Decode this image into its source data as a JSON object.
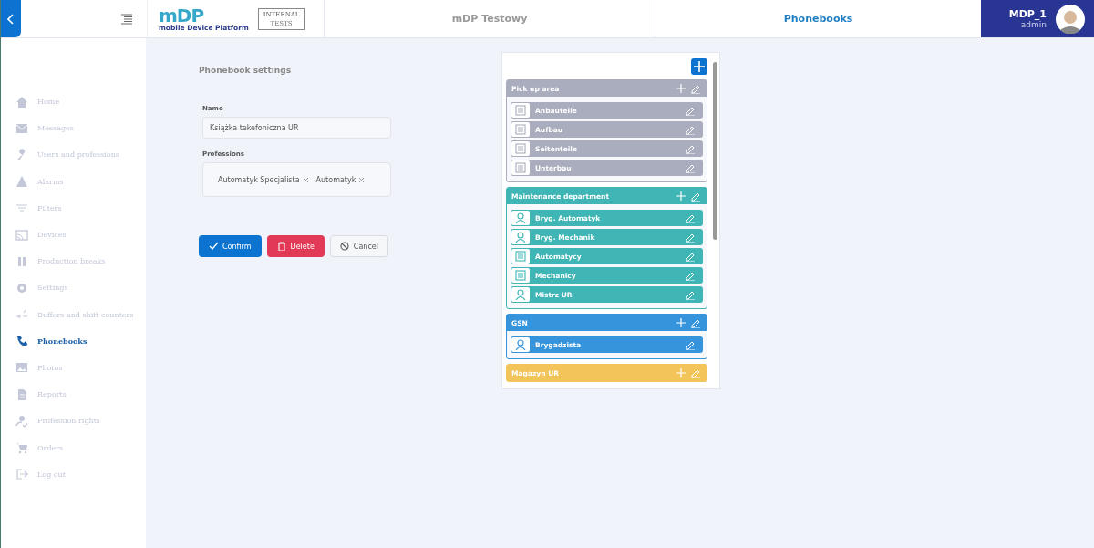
{
  "header": {
    "logo": {
      "mark": "mDP",
      "tagline": "mobile Device Platform"
    },
    "stamp": {
      "lines": [
        "INTERNAL",
        "TESTS"
      ]
    },
    "environment": "mDP Testowy",
    "page_title": "Phonebooks",
    "user": {
      "name": "MDP_1",
      "role": "admin"
    }
  },
  "sidebar": {
    "items": [
      {
        "label": "Home",
        "selected": false
      },
      {
        "label": "Messages",
        "selected": false
      },
      {
        "label": "Users and professions",
        "selected": false
      },
      {
        "label": "Alarms",
        "selected": false
      },
      {
        "label": "Filters",
        "selected": false
      },
      {
        "label": "Devices",
        "selected": false
      },
      {
        "label": "Production breaks",
        "selected": false
      },
      {
        "label": "Settings",
        "selected": false
      },
      {
        "label": "Buffers and shift counters",
        "selected": false
      },
      {
        "label": "Phonebooks",
        "selected": true
      },
      {
        "label": "Photos",
        "selected": false
      },
      {
        "label": "Reports",
        "selected": false
      },
      {
        "label": "Profession rights",
        "selected": false
      },
      {
        "label": "Orders",
        "selected": false
      },
      {
        "label": "Log out",
        "selected": false
      }
    ]
  },
  "form": {
    "title": "Phonebook settings",
    "name_label": "Name",
    "name_value": "Książka tekefoniczna UR",
    "professions_label": "Professions",
    "professions": [
      "Automatyk Specjalista",
      "Automatyk"
    ],
    "buttons": [
      {
        "label": "Confirm",
        "kind": "confirm"
      },
      {
        "label": "Delete",
        "kind": "delete"
      },
      {
        "label": "Cancel",
        "kind": "cancel"
      }
    ]
  },
  "groups": [
    {
      "title": "Pick up area",
      "color": "#a9adbd",
      "entries": [
        {
          "label": "Anbauteile",
          "kind": "group"
        },
        {
          "label": "Aufbau",
          "kind": "group"
        },
        {
          "label": "Seitenteile",
          "kind": "group"
        },
        {
          "label": "Unterbau",
          "kind": "group"
        }
      ]
    },
    {
      "title": "Maintenance department",
      "color": "#3fb5b5",
      "entries": [
        {
          "label": "Bryg. Automatyk",
          "kind": "person"
        },
        {
          "label": "Bryg. Mechanik",
          "kind": "person"
        },
        {
          "label": "Automatycy",
          "kind": "group"
        },
        {
          "label": "Mechanicy",
          "kind": "group"
        },
        {
          "label": "Mistrz UR",
          "kind": "person"
        }
      ]
    },
    {
      "title": "GSN",
      "color": "#3594dc",
      "entries": [
        {
          "label": "Brygadzista",
          "kind": "person"
        }
      ]
    },
    {
      "title": "Magazyn UR",
      "color": "#f2c45a"
    }
  ]
}
